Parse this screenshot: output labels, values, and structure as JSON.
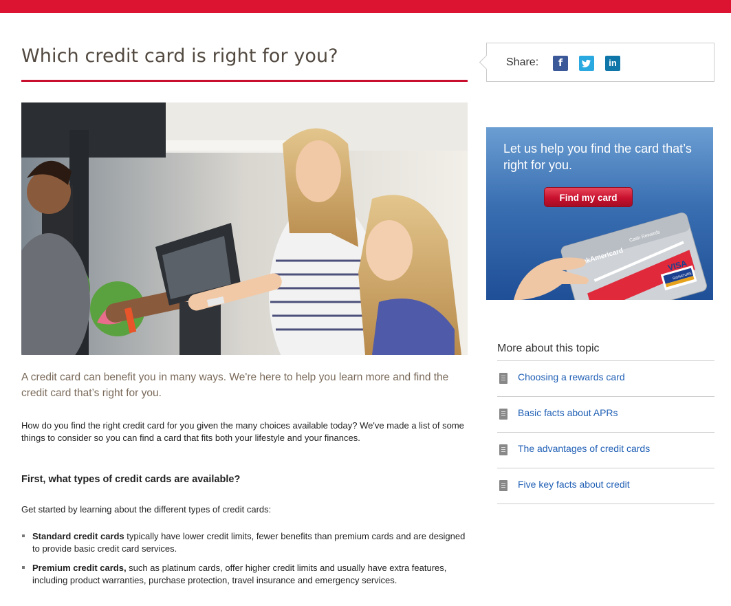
{
  "page": {
    "title": "Which credit card is right for you?",
    "intro": "A credit card can benefit you in many ways. We're here to help you learn more and find the credit card that’s right for you.",
    "paragraph": "How do you find the right credit card for you given the many choices available today? We've made a list of some things to consider so you can find a card that fits both your lifestyle and your finances.",
    "heading2": "First, what types of credit cards are available?",
    "get_started": "Get started by learning about the different types of credit cards:",
    "bullets": [
      {
        "bold": "Standard credit cards",
        "text": " typically have lower credit limits, fewer benefits than premium cards and are designed to provide basic credit card services."
      },
      {
        "bold": "Premium credit cards,",
        "text": " such as platinum cards, offer higher credit limits and usually have extra features, including product warranties, purchase protection, travel insurance and emergency services."
      }
    ]
  },
  "share": {
    "label": "Share:",
    "buttons": [
      {
        "icon": "facebook-icon",
        "glyph": "f"
      },
      {
        "icon": "twitter-icon",
        "glyph": "t"
      },
      {
        "icon": "linkedin-icon",
        "glyph": "in"
      }
    ]
  },
  "promo": {
    "text": "Let us help you find the card that’s right for you.",
    "button": "Find my card",
    "card_brand": "BankAmericard",
    "card_product": "Cash Rewards",
    "card_network": "VISA",
    "card_network_sub": "SIGNATURE"
  },
  "more": {
    "title": "More about this topic",
    "links": [
      "Choosing a rewards card",
      "Basic facts about APRs",
      "The advantages of credit cards",
      "Five key facts about credit"
    ]
  },
  "colors": {
    "brand_red": "#dc1431",
    "link_blue": "#1f5fb5",
    "intro_brown": "#7a6a5a"
  }
}
